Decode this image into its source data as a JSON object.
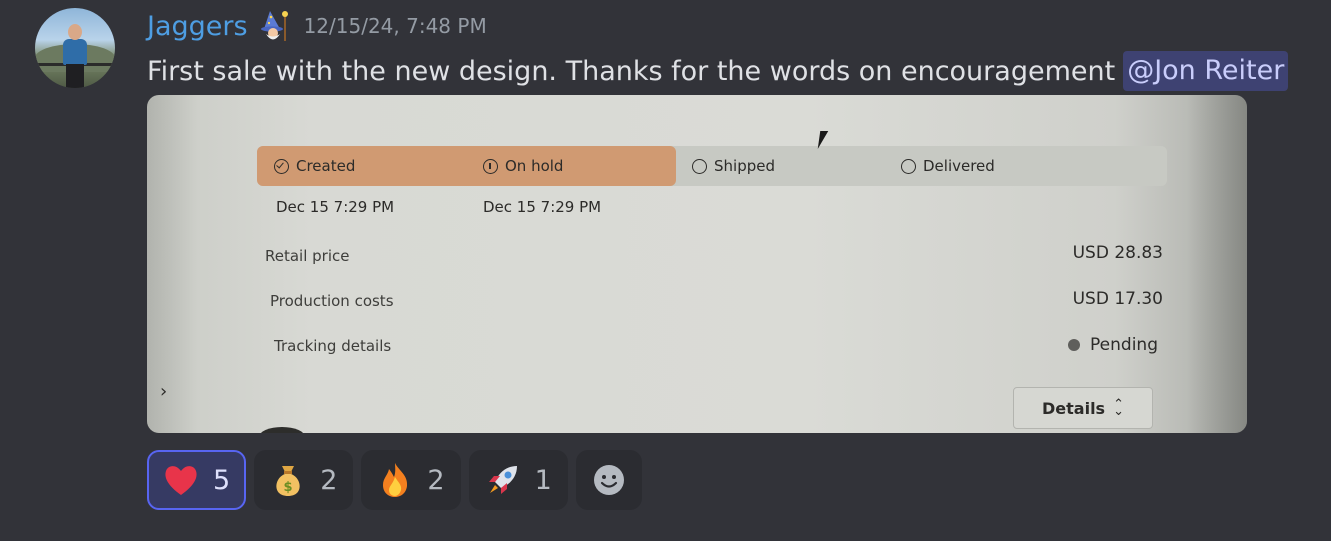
{
  "message": {
    "username": "Jaggers",
    "timestamp": "12/15/24, 7:48 PM",
    "text": "First sale with the new design. Thanks for the words on encouragement",
    "mention": "@Jon Reiter",
    "username_color": "#4e9ee3",
    "badge_icon": "wizard-icon"
  },
  "attachment": {
    "steps": [
      {
        "label": "Created",
        "icon": "check-circle-icon"
      },
      {
        "label": "On hold",
        "icon": "info-circle-icon"
      },
      {
        "label": "Shipped",
        "icon": "circle-icon"
      },
      {
        "label": "Delivered",
        "icon": "circle-icon"
      }
    ],
    "progress_fraction": 0.46,
    "dates": [
      "Dec 15 7:29 PM",
      "Dec 15 7:29 PM"
    ],
    "rows": [
      {
        "label": "Retail price",
        "value": "USD 28.83"
      },
      {
        "label": "Production costs",
        "value": "USD 17.30"
      },
      {
        "label": "Tracking details",
        "value": "Pending"
      }
    ],
    "details_label": "Details",
    "accent_color": "#d09a72"
  },
  "reactions": [
    {
      "emoji": "heart",
      "count": "5",
      "active": true
    },
    {
      "emoji": "money-bag",
      "count": "2",
      "active": false
    },
    {
      "emoji": "fire",
      "count": "2",
      "active": false
    },
    {
      "emoji": "rocket",
      "count": "1",
      "active": false
    }
  ],
  "add_reaction_icon": "add-reaction-icon"
}
